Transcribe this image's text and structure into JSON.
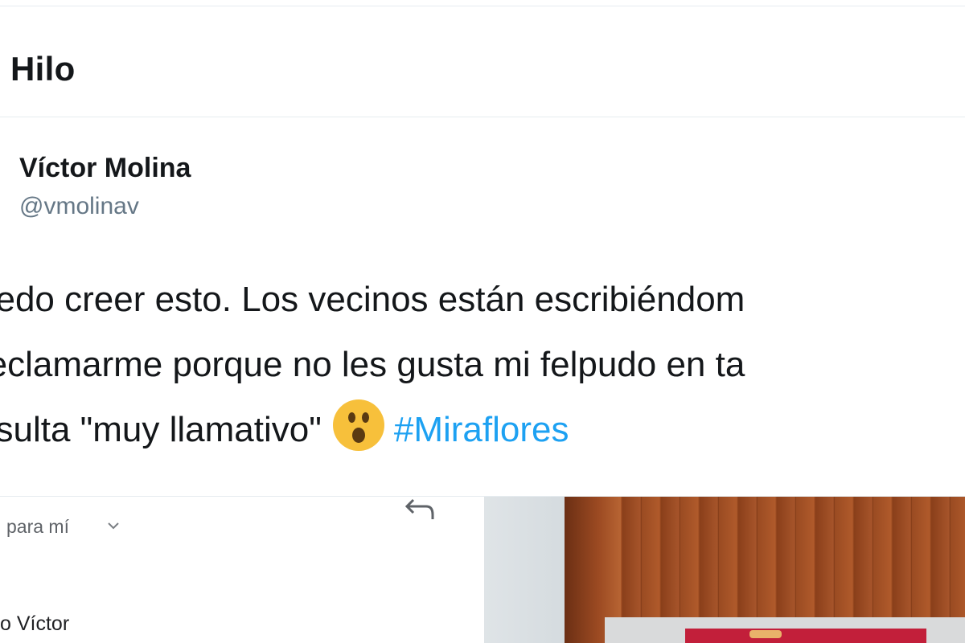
{
  "header": {
    "title": "Hilo"
  },
  "tweet": {
    "author_name": "Víctor Molina",
    "author_handle": "@vmolinav",
    "text_line_1": "uedo creer esto. Los vecinos están escribiéndom",
    "text_line_2": "reclamarme porque no les gusta mi felpudo en ta",
    "text_line_3_prefix": "esulta \"muy llamativo\"",
    "emoji": "astonished-face-icon",
    "hashtag": "#Miraflores"
  },
  "media": {
    "recipient_label": "para mí",
    "greeting": "o Víctor"
  },
  "colors": {
    "hashtag": "#1da1f2",
    "handle": "#657786",
    "divider": "#e6ecf0"
  }
}
